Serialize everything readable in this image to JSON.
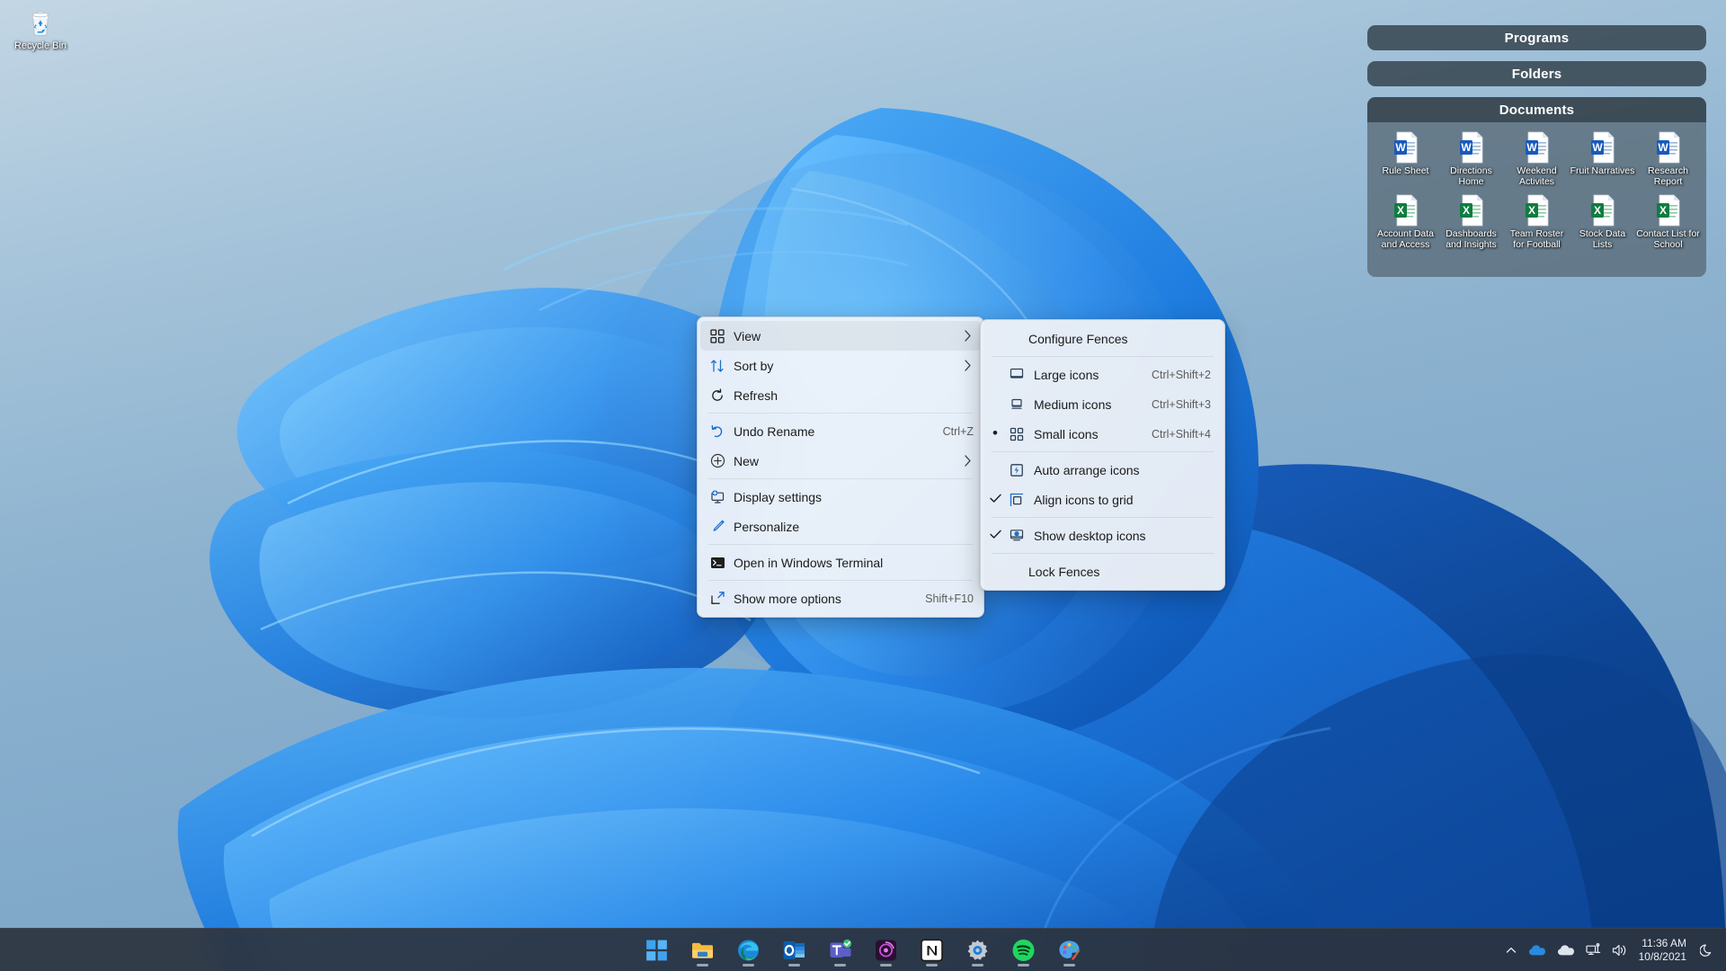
{
  "desktop": {
    "recycle_bin": {
      "label": "Recycle Bin",
      "icon": "recycle-bin-icon"
    }
  },
  "fences": [
    {
      "id": "programs",
      "title": "Programs",
      "items": []
    },
    {
      "id": "folders",
      "title": "Folders",
      "items": []
    },
    {
      "id": "documents",
      "title": "Documents",
      "rows": [
        [
          {
            "label": "Rule Sheet",
            "type": "word"
          },
          {
            "label": "Directions Home",
            "type": "word"
          },
          {
            "label": "Weekend Activites",
            "type": "word"
          },
          {
            "label": "Fruit Narratives",
            "type": "word"
          },
          {
            "label": "Research Report",
            "type": "word"
          }
        ],
        [
          {
            "label": "Account Data and Access",
            "type": "excel"
          },
          {
            "label": "Dashboards and Insights",
            "type": "excel"
          },
          {
            "label": "Team Roster for Football",
            "type": "excel"
          },
          {
            "label": "Stock Data Lists",
            "type": "excel"
          },
          {
            "label": "Contact List for School",
            "type": "excel"
          }
        ]
      ]
    }
  ],
  "context_menu": {
    "items": [
      {
        "label": "View",
        "icon": "grid-icon",
        "accel": "",
        "submenu": true,
        "highlighted": true
      },
      {
        "label": "Sort by",
        "icon": "sort-icon",
        "accel": "",
        "submenu": true,
        "highlighted": false
      },
      {
        "label": "Refresh",
        "icon": "refresh-icon",
        "accel": "",
        "submenu": false,
        "highlighted": false
      },
      {
        "separator": true
      },
      {
        "label": "Undo Rename",
        "icon": "undo-icon",
        "accel": "Ctrl+Z",
        "submenu": false,
        "highlighted": false
      },
      {
        "label": "New",
        "icon": "plus-circle-icon",
        "accel": "",
        "submenu": true,
        "highlighted": false
      },
      {
        "separator": true
      },
      {
        "label": "Display settings",
        "icon": "monitor-icon",
        "accel": "",
        "submenu": false,
        "highlighted": false
      },
      {
        "label": "Personalize",
        "icon": "brush-icon",
        "accel": "",
        "submenu": false,
        "highlighted": false
      },
      {
        "separator": true
      },
      {
        "label": "Open in Windows Terminal",
        "icon": "terminal-icon",
        "accel": "",
        "submenu": false,
        "highlighted": false
      },
      {
        "separator": true
      },
      {
        "label": "Show more options",
        "icon": "expand-icon",
        "accel": "Shift+F10",
        "submenu": false,
        "highlighted": false
      }
    ]
  },
  "submenu": {
    "items": [
      {
        "label": "Configure Fences",
        "icon": "",
        "accel": "",
        "mark": ""
      },
      {
        "separator": true
      },
      {
        "label": "Large icons",
        "icon": "large-icons-icon",
        "accel": "Ctrl+Shift+2",
        "mark": ""
      },
      {
        "label": "Medium icons",
        "icon": "medium-icons-icon",
        "accel": "Ctrl+Shift+3",
        "mark": ""
      },
      {
        "label": "Small icons",
        "icon": "small-icons-icon",
        "accel": "Ctrl+Shift+4",
        "mark": "dot"
      },
      {
        "separator": true
      },
      {
        "label": "Auto arrange icons",
        "icon": "auto-arrange-icon",
        "accel": "",
        "mark": ""
      },
      {
        "label": "Align icons to grid",
        "icon": "align-grid-icon",
        "accel": "",
        "mark": "check"
      },
      {
        "separator": true
      },
      {
        "label": "Show desktop icons",
        "icon": "show-desktop-icon",
        "accel": "",
        "mark": "check"
      },
      {
        "separator": true
      },
      {
        "label": "Lock Fences",
        "icon": "",
        "accel": "",
        "mark": ""
      }
    ]
  },
  "taskbar": {
    "apps": [
      {
        "name": "start-button",
        "label": "Start",
        "running": false
      },
      {
        "name": "file-explorer-button",
        "label": "File Explorer",
        "running": true
      },
      {
        "name": "edge-button",
        "label": "Microsoft Edge",
        "running": true
      },
      {
        "name": "outlook-button",
        "label": "Outlook",
        "running": true
      },
      {
        "name": "teams-button",
        "label": "Microsoft Teams",
        "running": true
      },
      {
        "name": "media-button",
        "label": "Media Player",
        "running": true
      },
      {
        "name": "notion-button",
        "label": "Notion",
        "running": true
      },
      {
        "name": "settings-button",
        "label": "Settings",
        "running": true
      },
      {
        "name": "spotify-button",
        "label": "Spotify",
        "running": true
      },
      {
        "name": "paint-button",
        "label": "Paint",
        "running": true
      }
    ],
    "tray": {
      "chevron": "show-hidden-icons",
      "onedrive": "onedrive-icon",
      "cloud": "cloud-icon",
      "network": "network-icon",
      "volume": "volume-icon",
      "time": "11:36 AM",
      "date": "10/8/2021",
      "notifications": "moon-icon"
    }
  },
  "colors": {
    "fence_header": "#394853",
    "fence_body": "#5a6c78",
    "taskbar": "#2c343f",
    "menu_bg": "#f3f5fa",
    "accent": "#0078d4"
  }
}
